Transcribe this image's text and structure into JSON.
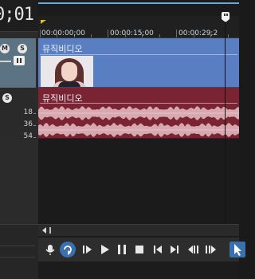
{
  "header": {
    "timecode": "0;01"
  },
  "ruler": {
    "timecodes": [
      {
        "label": "00:00:00;00"
      },
      {
        "label": "00:00:15;00"
      },
      {
        "label": "00:00:29;2"
      }
    ]
  },
  "tracks": [
    {
      "type": "video",
      "clip_title": "뮤직비디오",
      "color": "#5a7ec2"
    },
    {
      "type": "audio",
      "clip_title": "뮤직비디오",
      "color": "#7a2433"
    }
  ],
  "audio_meter": {
    "labels": [
      "18",
      "36",
      "54"
    ]
  },
  "track_header_buttons": {
    "video": [
      "M",
      "S"
    ],
    "audio": [
      "S"
    ]
  },
  "transport": {
    "buttons": [
      "record",
      "loop",
      "play-from-start",
      "play",
      "pause",
      "stop",
      "go-to-start",
      "go-to-end",
      "previous-frame",
      "next-frame",
      "normal-edit-tool"
    ]
  },
  "colors": {
    "accent": "#3a6fb0",
    "playhead": "#f2f2f2",
    "loop_marker": "#e6c300"
  }
}
